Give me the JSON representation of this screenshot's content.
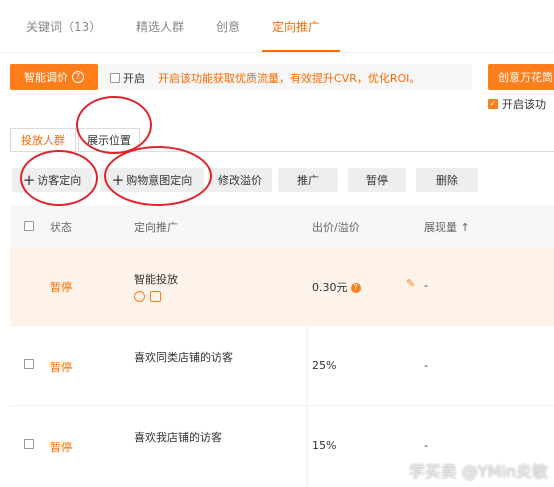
{
  "top_tabs": [
    {
      "label": "关键词（13）",
      "active": false
    },
    {
      "label": "精选人群",
      "active": false
    },
    {
      "label": "创意",
      "active": false
    },
    {
      "label": "定向推广",
      "active": true
    }
  ],
  "smart_bid": {
    "button_label": "智能调价",
    "open_label": "开启",
    "tip": "开启该功能获取优质流量，有效提升CVR，优化ROI。"
  },
  "creative": {
    "button_label": "创意万花筒",
    "check_label": "开启该功"
  },
  "sub_tabs": [
    {
      "label": "投放人群",
      "active": true
    },
    {
      "label": "展示位置",
      "active": false
    }
  ],
  "actions": [
    {
      "label": "访客定向",
      "plus": "+"
    },
    {
      "label": "购物意图定向",
      "plus": "+"
    },
    {
      "label": "修改溢价"
    },
    {
      "label": "推广"
    },
    {
      "label": "暂停"
    },
    {
      "label": "删除"
    }
  ],
  "table": {
    "headers": {
      "status": "状态",
      "target": "定向推广",
      "price": "出价/溢价",
      "impressions": "展现量 ↑"
    },
    "rows": [
      {
        "status": "暂停",
        "target": "智能投放",
        "price": "0.30元",
        "impressions": "-"
      },
      {
        "status": "暂停",
        "target": "喜欢同类店铺的访客",
        "price": "25%",
        "impressions": "-"
      },
      {
        "status": "暂停",
        "target": "喜欢我店铺的访客",
        "price": "15%",
        "impressions": "-"
      }
    ]
  },
  "watermark": "学买卖 @YMin炎敏",
  "colors": {
    "accent": "#ff6a00",
    "annotation": "#e0242b"
  }
}
